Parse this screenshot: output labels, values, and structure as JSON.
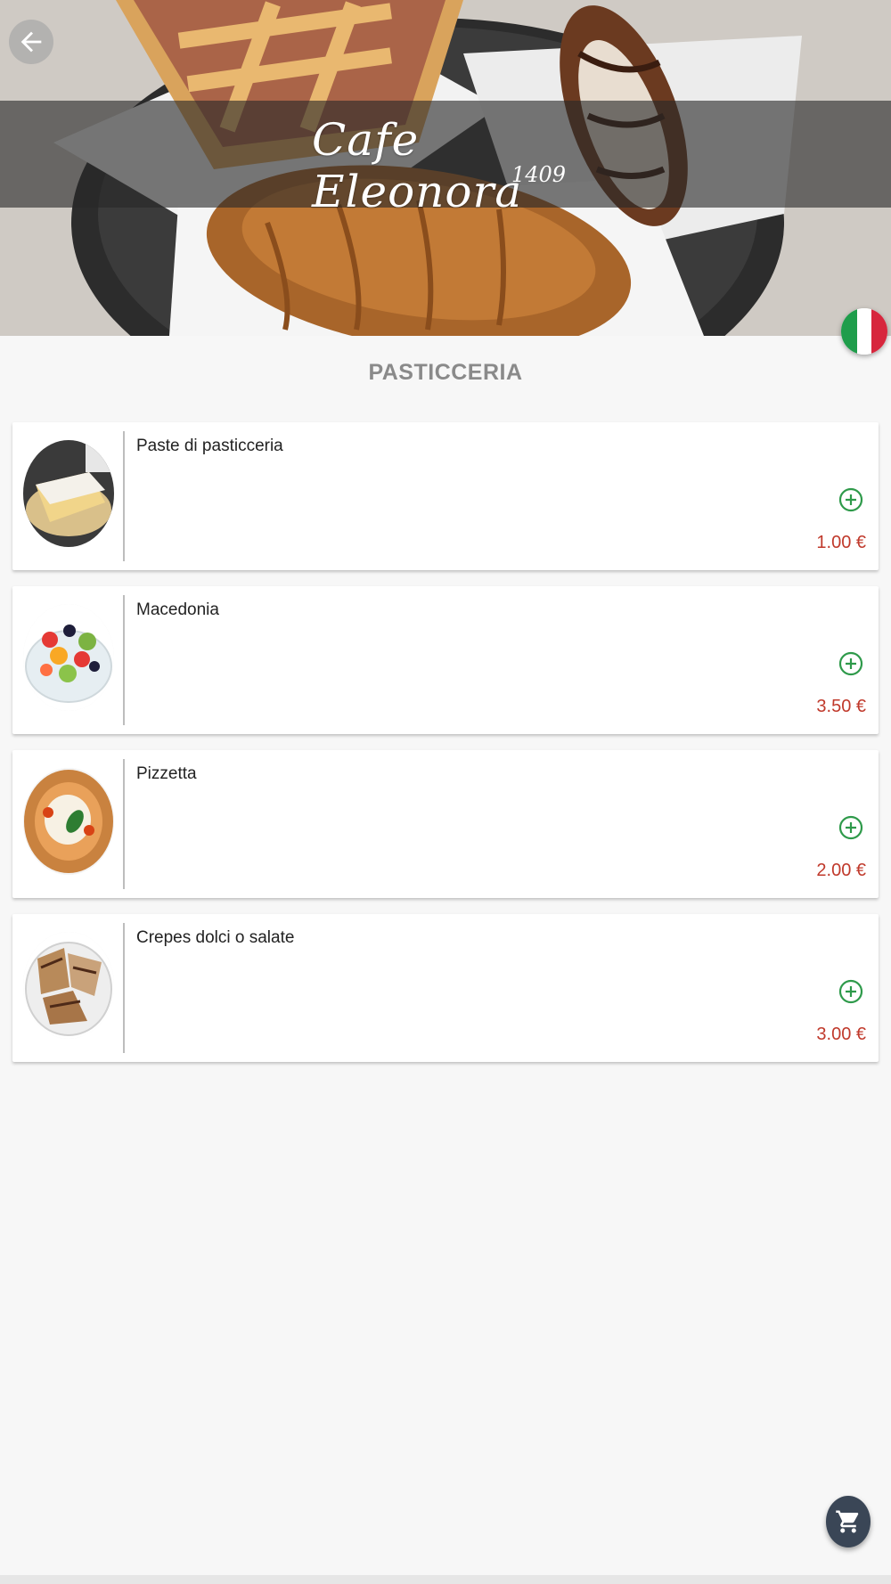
{
  "header": {
    "brand_name": "Cafe Eleonora",
    "brand_year": "1409"
  },
  "section": {
    "title": "PASTICCERIA"
  },
  "items": [
    {
      "name": "Paste di pasticceria",
      "price": "1.00 €"
    },
    {
      "name": "Macedonia",
      "price": "3.50 €"
    },
    {
      "name": "Pizzetta",
      "price": "2.00 €"
    },
    {
      "name": "Crepes dolci o salate",
      "price": "3.00 €"
    }
  ],
  "icons": {
    "back": "arrow-left-icon",
    "language": "italy-flag-icon",
    "add": "plus-circle-icon",
    "cart": "shopping-cart-icon"
  },
  "colors": {
    "price": "#c0392b",
    "add_icon": "#2e9a4a",
    "cart_fab": "#3a4656",
    "section_title": "#8a8a8a"
  }
}
